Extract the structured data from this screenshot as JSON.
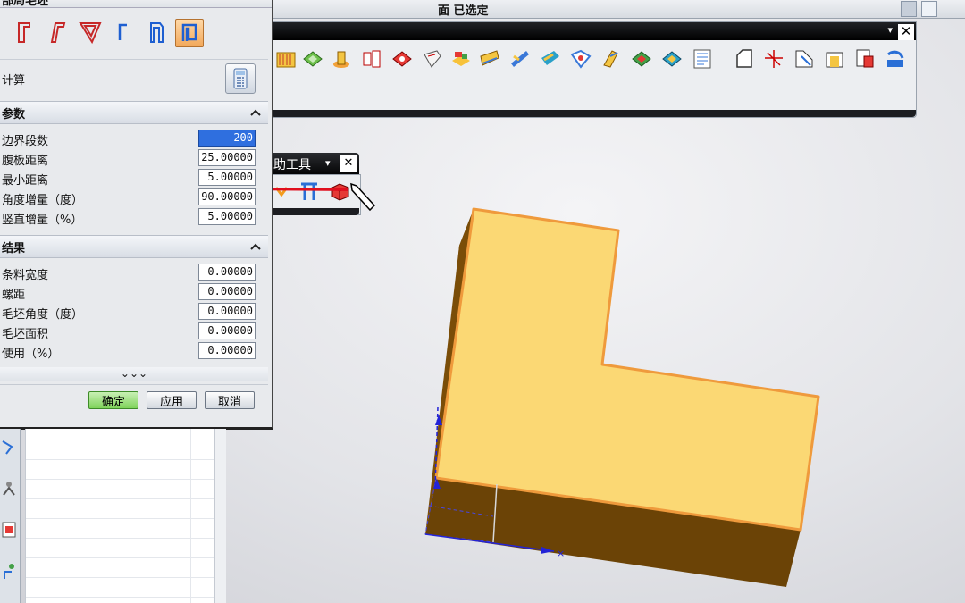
{
  "window": {
    "status_text": "面 已选定"
  },
  "dialog": {
    "title": "部局毛坯",
    "close_glyph": "×",
    "shape_buttons": [
      {
        "icon": "flange-profile-1-icon"
      },
      {
        "icon": "flange-profile-2-icon"
      },
      {
        "icon": "flange-profile-3-icon"
      },
      {
        "icon": "flange-profile-4-icon"
      },
      {
        "icon": "flange-profile-5-icon"
      },
      {
        "icon": "flange-profile-6-icon",
        "active": true
      }
    ],
    "calc_label": "计算",
    "params": {
      "header": "参数",
      "rows": [
        {
          "label": "边界段数",
          "value": "200"
        },
        {
          "label": "腹板距离",
          "value": "25.00000"
        },
        {
          "label": "最小距离",
          "value": "5.00000"
        },
        {
          "label": "角度增量（度）",
          "value": "90.00000"
        },
        {
          "label": "竖直增量（%）",
          "value": "5.00000"
        }
      ]
    },
    "results": {
      "header": "结果",
      "rows": [
        {
          "label": "条料宽度",
          "value": "0.00000"
        },
        {
          "label": "螺距",
          "value": "0.00000"
        },
        {
          "label": "毛坯角度（度）",
          "value": "0.00000"
        },
        {
          "label": "毛坯面积",
          "value": "0.00000"
        },
        {
          "label": "使用（%）",
          "value": "0.00000"
        }
      ]
    },
    "more_glyph": "⌄⌄⌄",
    "buttons": {
      "ok": "确定",
      "apply": "应用",
      "cancel": "取消"
    }
  },
  "toolbar": {
    "menu_glyph": "▾",
    "close_glyph": "✕"
  },
  "mini_toolbar": {
    "title": "助工具",
    "menu_glyph": "▾",
    "close_glyph": "✕"
  },
  "colors": {
    "part_top": "#fbd874",
    "part_side": "#6b4306",
    "part_edge": "#ef9a3c",
    "annotation_red": "#e0101e",
    "axis_blue": "#2323d6"
  }
}
